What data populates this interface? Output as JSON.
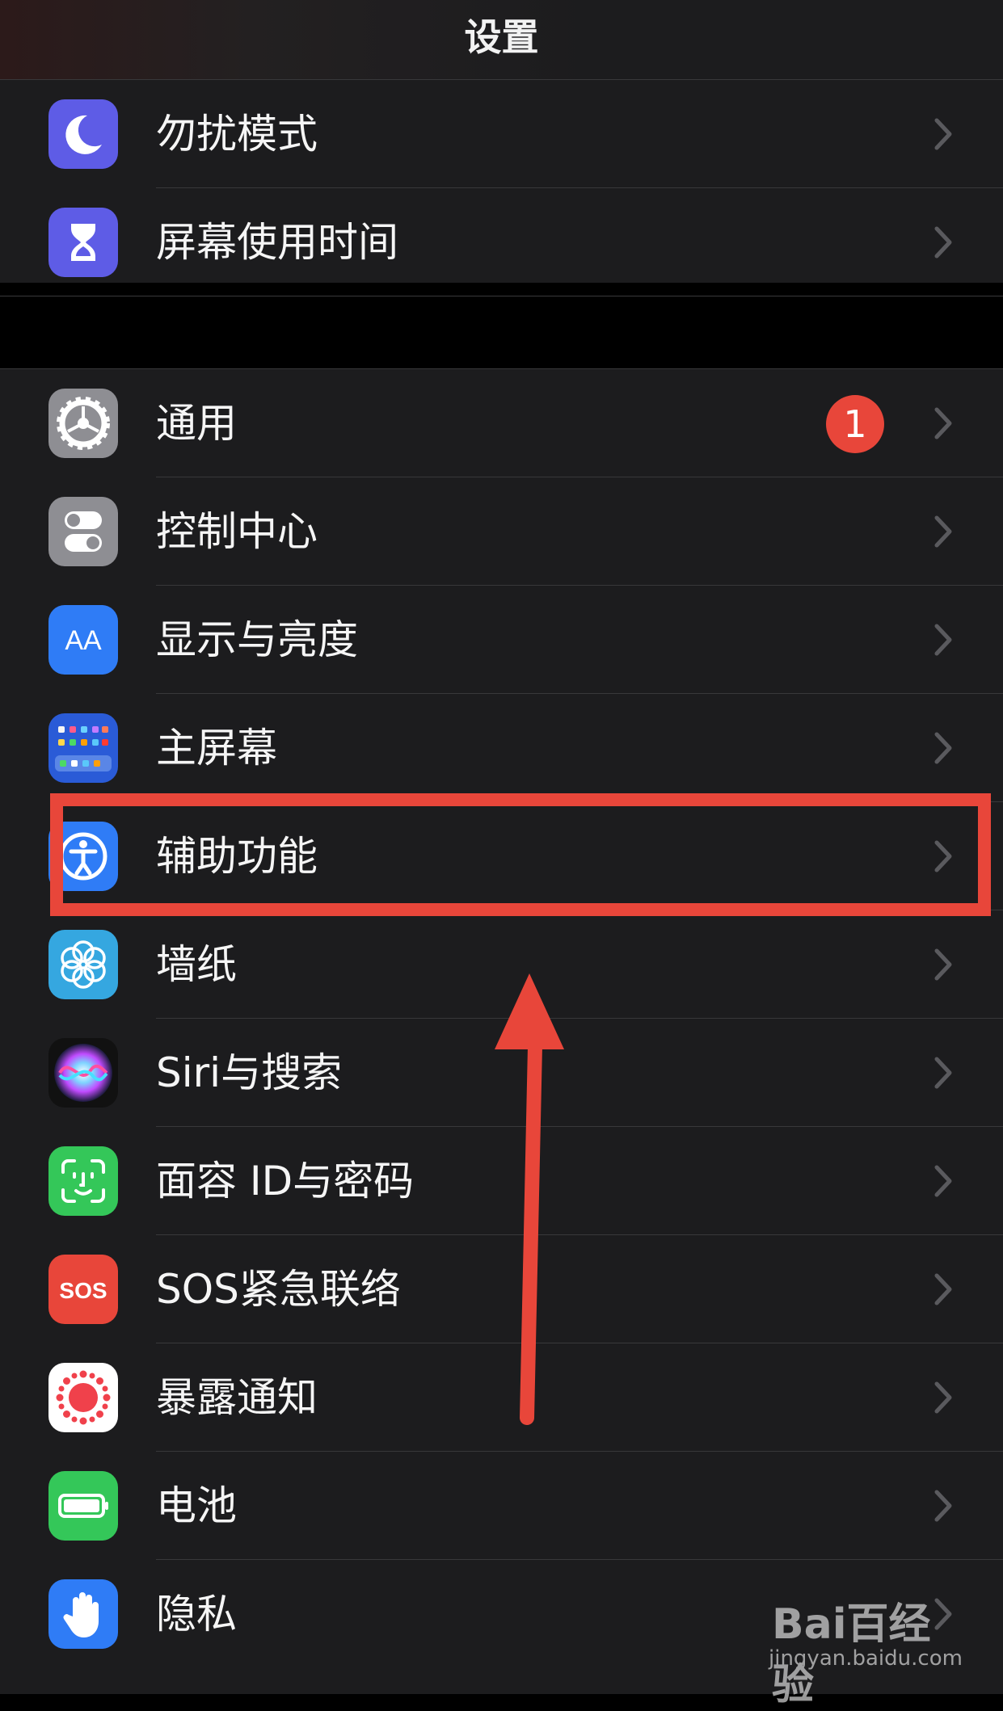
{
  "header": {
    "title": "设置"
  },
  "group1": [
    {
      "label": "勿扰模式",
      "icon": "moon-icon"
    },
    {
      "label": "屏幕使用时间",
      "icon": "hourglass-icon"
    }
  ],
  "group2": [
    {
      "label": "通用",
      "icon": "gear-icon",
      "badge": "1"
    },
    {
      "label": "控制中心",
      "icon": "toggles-icon"
    },
    {
      "label": "显示与亮度",
      "icon": "text-size-icon",
      "icon_text": "AA"
    },
    {
      "label": "主屏幕",
      "icon": "home-screen-grid-icon"
    },
    {
      "label": "辅助功能",
      "icon": "accessibility-icon"
    },
    {
      "label": "墙纸",
      "icon": "flower-icon"
    },
    {
      "label": "Siri与搜索",
      "icon": "siri-icon"
    },
    {
      "label": "面容 ID与密码",
      "icon": "face-id-icon"
    },
    {
      "label": "SOS紧急联络",
      "icon": "sos-icon",
      "icon_text": "SOS"
    },
    {
      "label": "暴露通知",
      "icon": "exposure-icon"
    },
    {
      "label": "电池",
      "icon": "battery-icon"
    },
    {
      "label": "隐私",
      "icon": "hand-icon"
    }
  ],
  "colors": {
    "background": "#1c1c1e",
    "separator": "#38383a",
    "badge": "#e8463a",
    "annotation_red": "#e8463a"
  },
  "watermark": {
    "logo": "Bai百经验",
    "url": "jingyan.baidu.com"
  }
}
